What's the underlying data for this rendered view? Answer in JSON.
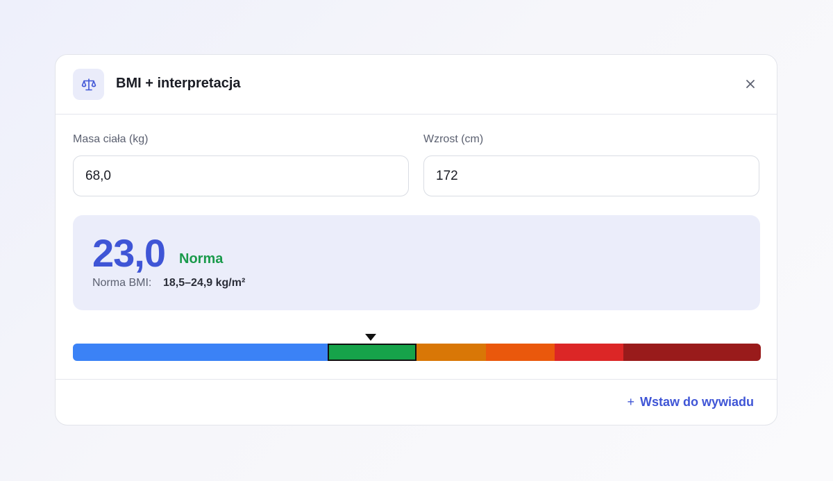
{
  "header": {
    "title": "BMI + interpretacja",
    "icon": "scale-balance-icon",
    "close_icon": "close-icon"
  },
  "inputs": {
    "weight": {
      "label": "Masa ciała (kg)",
      "value": "68,0"
    },
    "height": {
      "label": "Wzrost (cm)",
      "value": "172"
    }
  },
  "result": {
    "bmi": "23,0",
    "category": "Norma",
    "norm_label": "Norma BMI:",
    "norm_range": "18,5–24,9 kg/m²"
  },
  "scale": {
    "segments": [
      {
        "name": "underweight",
        "color": "#3b82f6",
        "share": 37
      },
      {
        "name": "normal",
        "color": "#16a34a",
        "share": 13,
        "active": true
      },
      {
        "name": "overweight",
        "color": "#d97706",
        "share": 10
      },
      {
        "name": "obesity-1",
        "color": "#ea580c",
        "share": 10
      },
      {
        "name": "obesity-2",
        "color": "#dc2626",
        "share": 10
      },
      {
        "name": "obesity-3",
        "color": "#991b1b",
        "share": 20
      }
    ]
  },
  "footer": {
    "insert_icon": "plus-icon",
    "insert_label": "Wstaw do wywiadu"
  },
  "colors": {
    "accent": "#3f55d6",
    "normal": "#1a9a4b"
  }
}
